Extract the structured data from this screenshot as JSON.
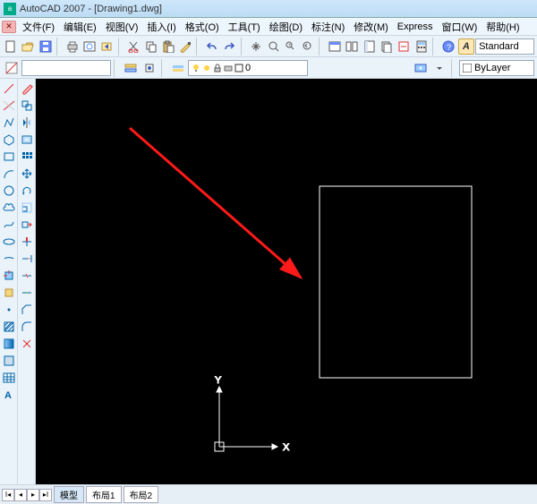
{
  "title": "AutoCAD 2007 - [Drawing1.dwg]",
  "menu": {
    "file": "文件(F)",
    "edit": "编辑(E)",
    "view": "视图(V)",
    "insert": "插入(I)",
    "format": "格式(O)",
    "tools": "工具(T)",
    "draw": "绘图(D)",
    "dimension": "标注(N)",
    "modify": "修改(M)",
    "express": "Express",
    "window": "窗口(W)",
    "help": "帮助(H)"
  },
  "layer_value": "0",
  "style_label": "Standard",
  "bylayer_label": "ByLayer",
  "aa_label": "A",
  "ucs": {
    "x": "X",
    "y": "Y"
  },
  "tabs": {
    "model": "模型",
    "layout1": "布局1",
    "layout2": "布局2"
  }
}
